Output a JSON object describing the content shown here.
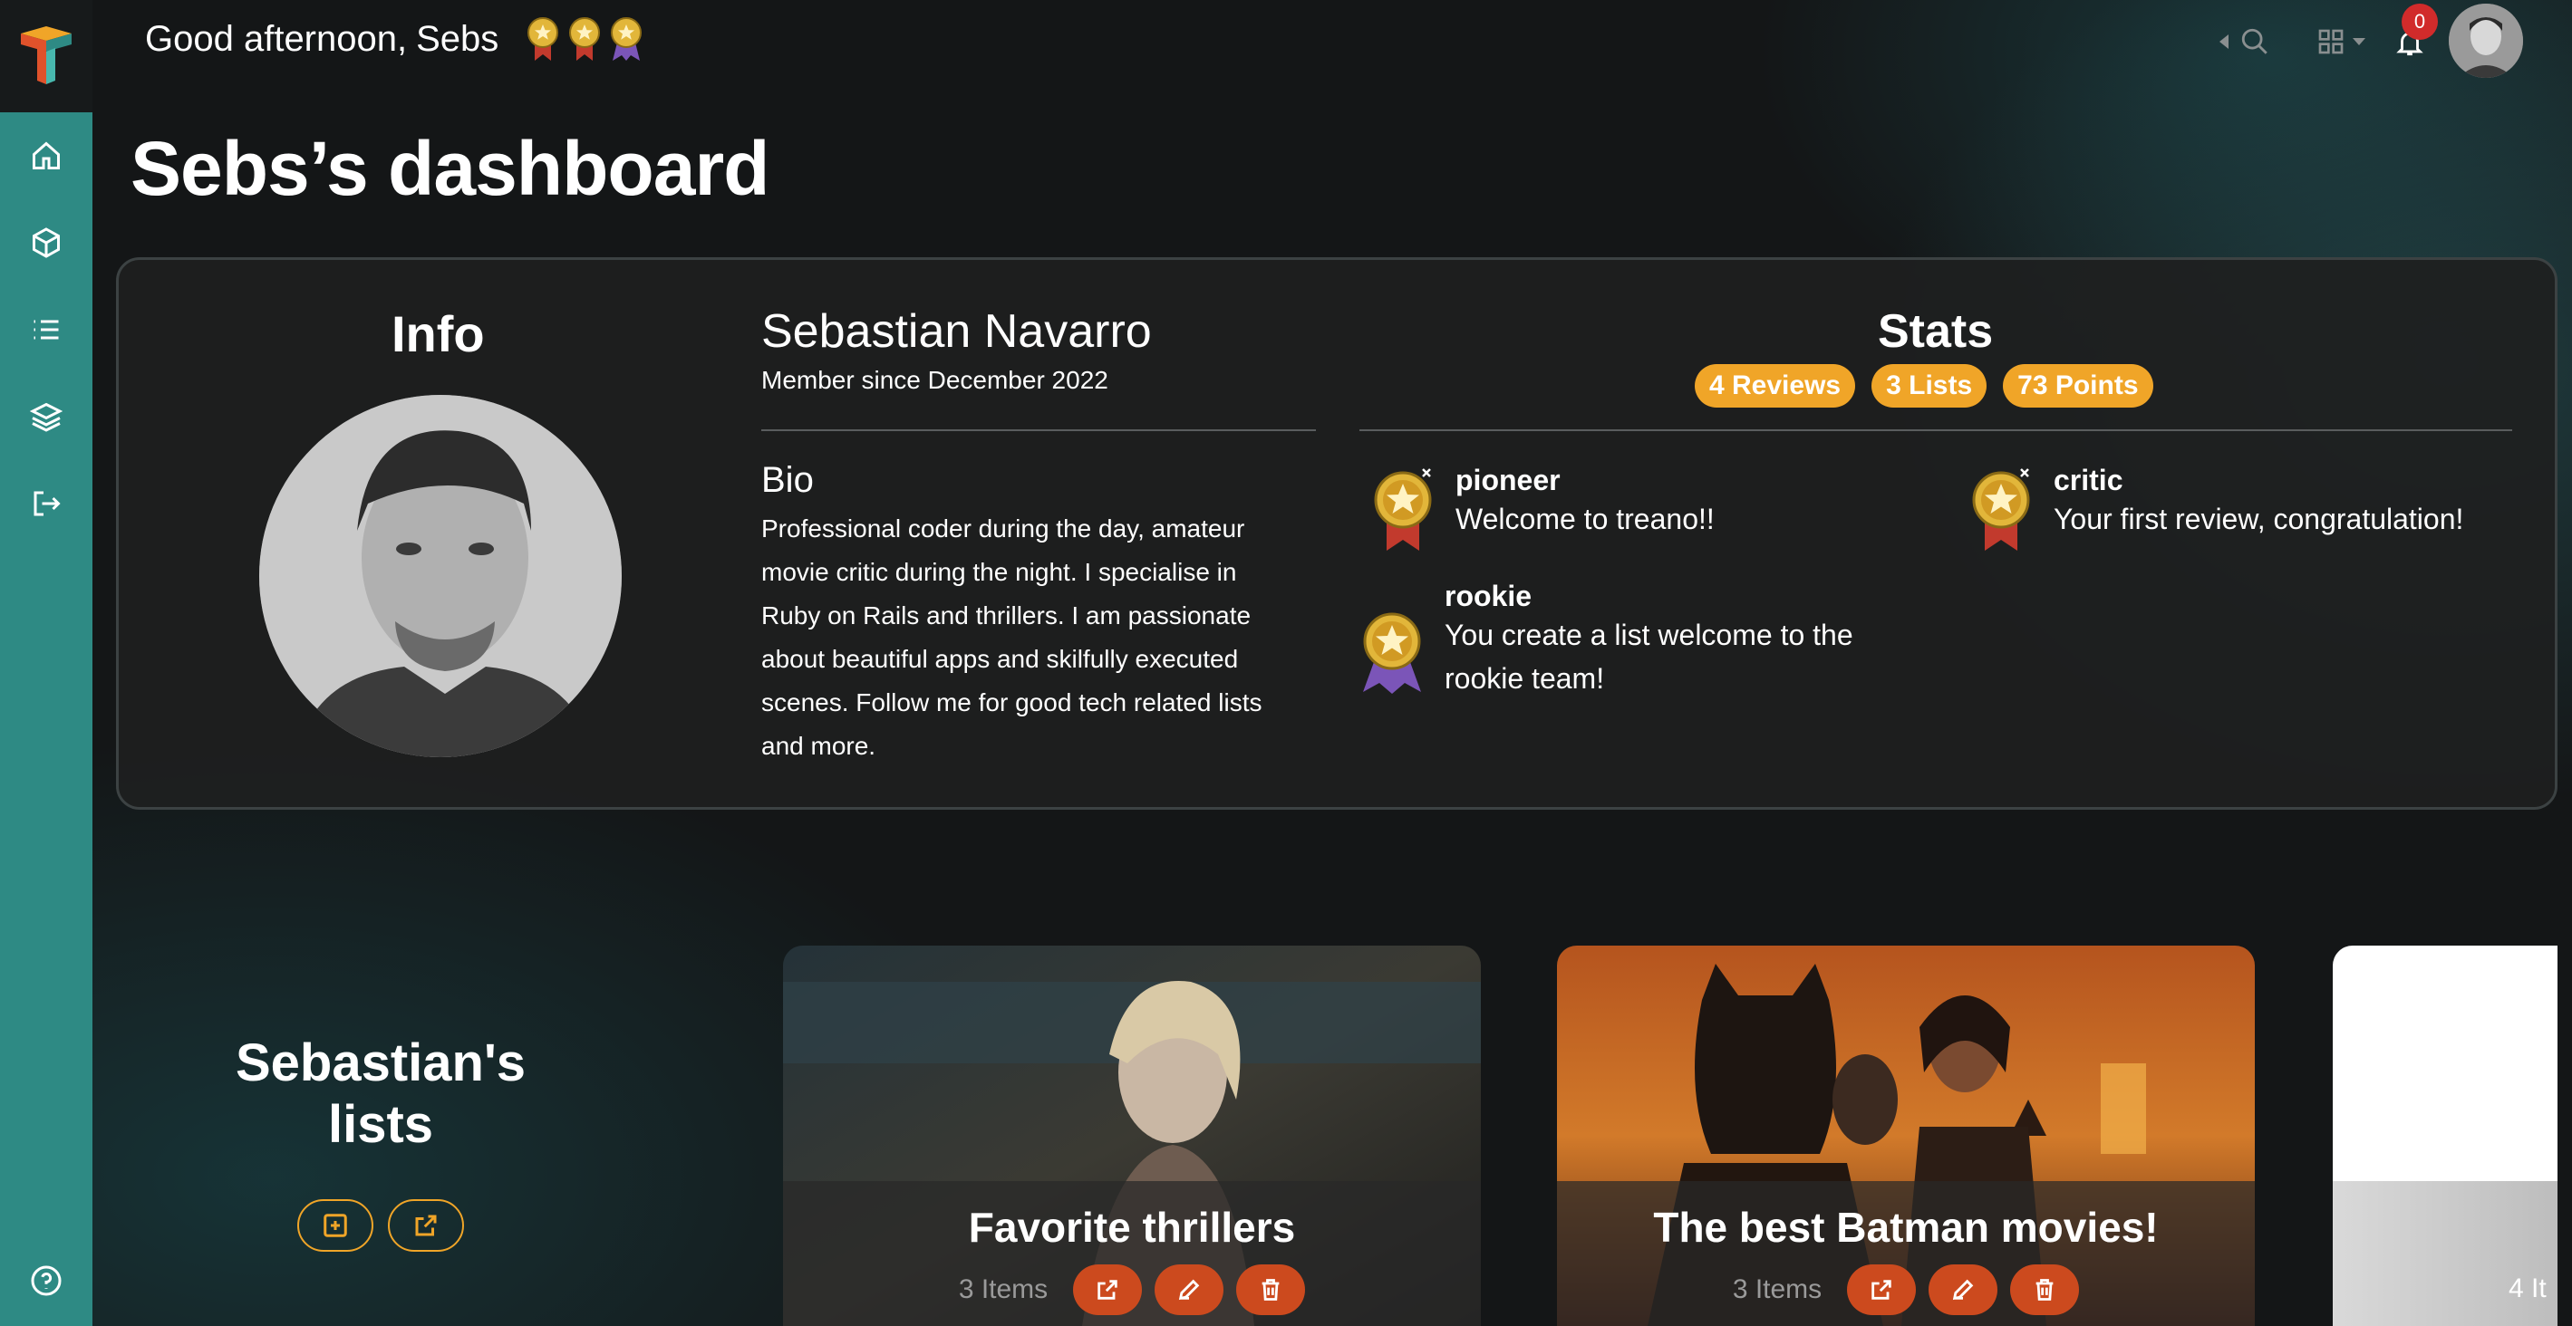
{
  "app": {
    "name": "treano"
  },
  "topbar": {
    "greeting": "Good afternoon,",
    "username": "Sebs",
    "notification_count": "0",
    "icons": [
      "caret-left-icon",
      "search-icon",
      "grid-icon",
      "caret-down-icon",
      "bell-icon"
    ]
  },
  "sidebar": {
    "items": [
      {
        "name": "home",
        "icon": "home-icon"
      },
      {
        "name": "products",
        "icon": "cube-icon"
      },
      {
        "name": "lists",
        "icon": "list-icon"
      },
      {
        "name": "layers",
        "icon": "layers-icon"
      },
      {
        "name": "logout",
        "icon": "logout-icon"
      }
    ],
    "footer_icon": "help-icon"
  },
  "page": {
    "title": "Sebs’s dashboard"
  },
  "info": {
    "heading": "Info",
    "full_name": "Sebastian Navarro",
    "member_since": "Member since December 2022",
    "bio_heading": "Bio",
    "bio_lines": [
      "Professional coder during the day, amateur",
      "movie critic during the night. I specialise in",
      "Ruby on Rails and thrillers. I am passionate",
      "about beautiful apps and skilfully executed",
      "scenes. Follow me for good tech related lists",
      "and more."
    ]
  },
  "stats": {
    "heading": "Stats",
    "pills": [
      "4 Reviews",
      "3 Lists",
      "73 Points"
    ],
    "badges": [
      {
        "title": "pioneer",
        "desc": [
          "Welcome to treano!!"
        ]
      },
      {
        "title": "critic",
        "desc": [
          "Your first review, congratulation!"
        ]
      },
      {
        "title": "rookie",
        "desc": [
          "You create a list welcome to the",
          "rookie team!"
        ]
      }
    ]
  },
  "lists": {
    "heading_line1": "Sebastian's",
    "heading_line2": "lists",
    "cards": [
      {
        "title": "Favorite thrillers",
        "count": "3 Items"
      },
      {
        "title": "The best Batman movies!",
        "count": "3 Items"
      }
    ],
    "partial_card_count": "4 It"
  },
  "colors": {
    "accent_orange": "#f0a528",
    "action_red": "#cc4a1e",
    "sidebar_teal": "#2e8a84",
    "badge_red": "#d12b2b"
  }
}
